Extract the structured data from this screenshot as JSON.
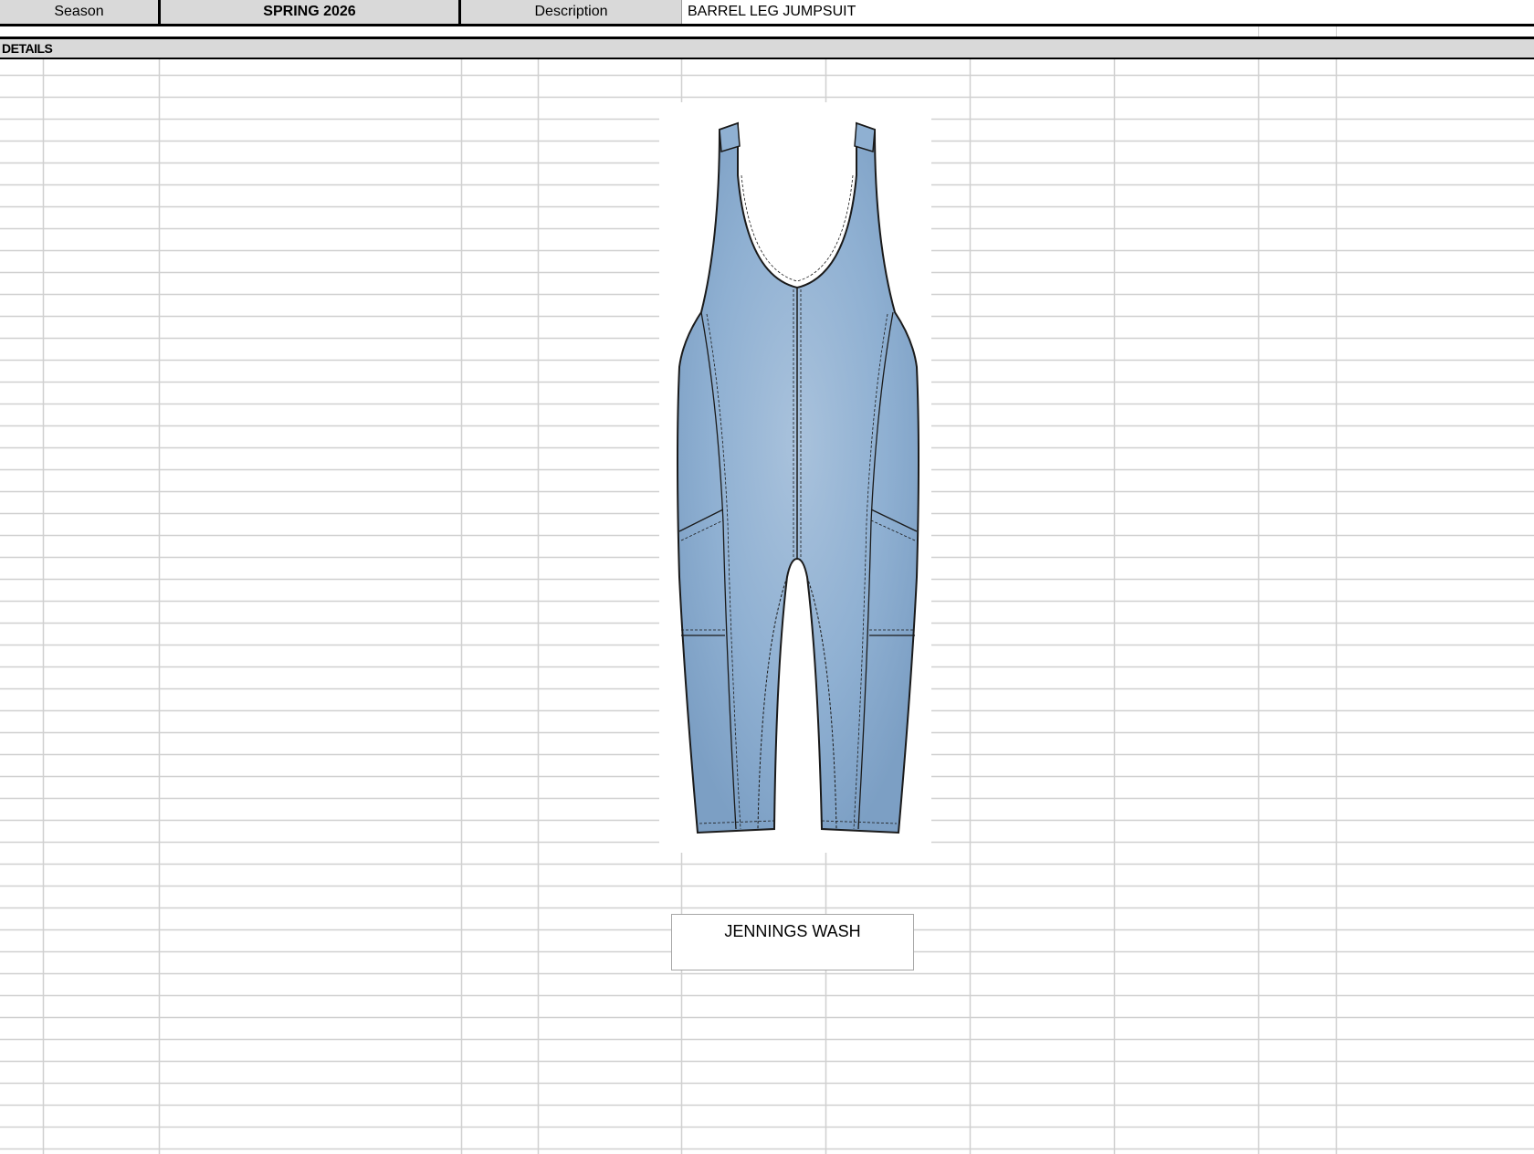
{
  "header": {
    "season_label": "Season",
    "season_value": "SPRING 2026",
    "description_label": "Description",
    "description_value": "BARREL LEG JUMPSUIT"
  },
  "section": {
    "details_label": "DETAILS"
  },
  "sketch": {
    "garment_icon": "jumpsuit-sketch",
    "fabric_color": "#8fb0d2",
    "wash_label": "JENNINGS WASH"
  },
  "colors": {
    "header_bg": "#d9d9d9",
    "gridline": "#d0d0d0",
    "border": "#000000"
  }
}
